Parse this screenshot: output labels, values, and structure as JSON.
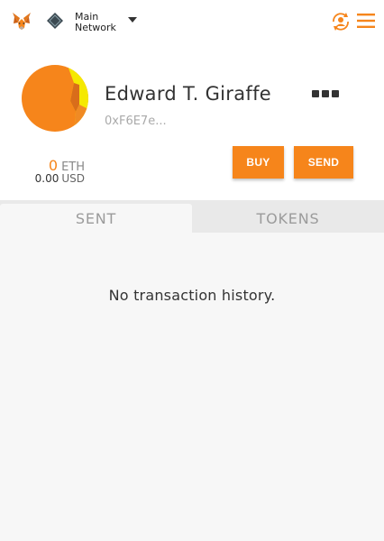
{
  "header": {
    "network_line1": "Main",
    "network_line2": "Network"
  },
  "account": {
    "name": "Edward T. Giraffe",
    "address": "0xF6E7e..."
  },
  "balance": {
    "eth_amount": "0",
    "eth_unit": "ETH",
    "usd_amount": "0.00",
    "usd_unit": "USD"
  },
  "actions": {
    "buy_label": "BUY",
    "send_label": "SEND"
  },
  "tabs": [
    {
      "label": "SENT",
      "active": true
    },
    {
      "label": "TOKENS",
      "active": false
    }
  ],
  "transactions": {
    "empty_text": "No transaction history."
  },
  "colors": {
    "accent": "#f6851b",
    "avatar_yellow": "#f5e900",
    "background": "#f7f7f7"
  },
  "icons": [
    "metamask-fox-icon",
    "network-diamond-icon",
    "chevron-down-icon",
    "account-switch-icon",
    "hamburger-menu-icon",
    "more-dots-icon"
  ]
}
